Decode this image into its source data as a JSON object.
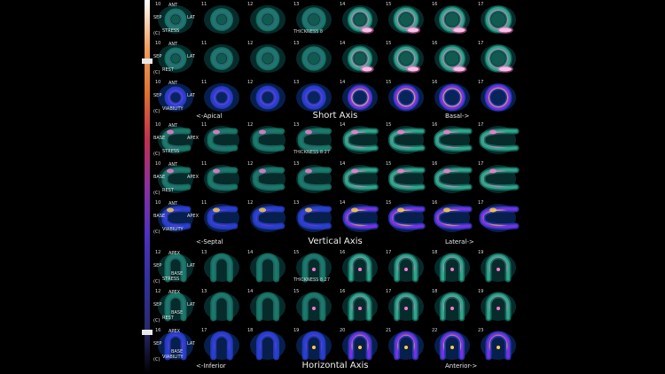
{
  "sections": [
    {
      "title": "Short Axis",
      "caption_left": "<-Apical",
      "caption_right": "Basal->",
      "orient": {
        "top": "ANT",
        "left": "SEP",
        "right": "LAT"
      },
      "rows": [
        {
          "label": "STRESS",
          "numbers": [
            "10",
            "11",
            "12",
            "13",
            "14",
            "15",
            "16",
            "17"
          ],
          "thickness": "THICKNESS 8"
        },
        {
          "label": "REST",
          "numbers": [
            "10",
            "11",
            "12",
            "13",
            "14",
            "15",
            "16",
            "17"
          ],
          "thickness": ""
        },
        {
          "label": "VIABILITY",
          "numbers": [
            "10",
            "11",
            "12",
            "13",
            "14",
            "15",
            "16",
            "17"
          ],
          "thickness": ""
        }
      ]
    },
    {
      "title": "Vertical Axis",
      "caption_left": "<-Septal",
      "caption_right": "Lateral->",
      "orient": {
        "top": "ANT",
        "left": "BASE",
        "right": "APEX"
      },
      "rows": [
        {
          "label": "STRESS",
          "numbers": [
            "10",
            "11",
            "12",
            "13",
            "14",
            "15",
            "16",
            "17"
          ],
          "thickness": "THICKNESS 8.27"
        },
        {
          "label": "REST",
          "numbers": [
            "10",
            "11",
            "12",
            "13",
            "14",
            "15",
            "16",
            "17"
          ],
          "thickness": ""
        },
        {
          "label": "VIABILITY",
          "numbers": [
            "10",
            "11",
            "12",
            "13",
            "14",
            "15",
            "16",
            "17"
          ],
          "thickness": ""
        }
      ]
    },
    {
      "title": "Horizontal Axis",
      "caption_left": "<-Inferior",
      "caption_right": "Anterior->",
      "orient": {
        "top": "APEX",
        "left": "SEP",
        "right": "LAT"
      },
      "rows": [
        {
          "label": "STRESS",
          "numbers": [
            "12",
            "13",
            "14",
            "15",
            "16",
            "17",
            "18",
            "19"
          ],
          "thickness": "THICKNESS 8.27"
        },
        {
          "label": "REST",
          "numbers": [
            "12",
            "13",
            "14",
            "15",
            "16",
            "17",
            "18",
            "19"
          ],
          "thickness": ""
        },
        {
          "label": "VIABILITY",
          "numbers": [
            "16",
            "17",
            "18",
            "19",
            "20",
            "21",
            "22",
            "23"
          ],
          "thickness": ""
        }
      ]
    }
  ],
  "row_prefix": "(C)",
  "base_label": "BASE",
  "colors": {
    "stress_rest_palette": [
      "#000000",
      "#0a3a3a",
      "#1a7a6a",
      "#2fa58a",
      "#6a3fb0",
      "#b040d0",
      "#ff7ad0",
      "#ffffff"
    ],
    "viability_palette": [
      "#000000",
      "#0a2a66",
      "#2a3fd0",
      "#7a30e0",
      "#c040d8",
      "#ff7a40",
      "#ffd040",
      "#fff5c0"
    ],
    "colorbar": [
      "#ffffff",
      "#f0a060",
      "#e07030",
      "#c03050",
      "#8a30a0",
      "#5030c0",
      "#3030a0",
      "#2a2a70",
      "#000000"
    ]
  }
}
